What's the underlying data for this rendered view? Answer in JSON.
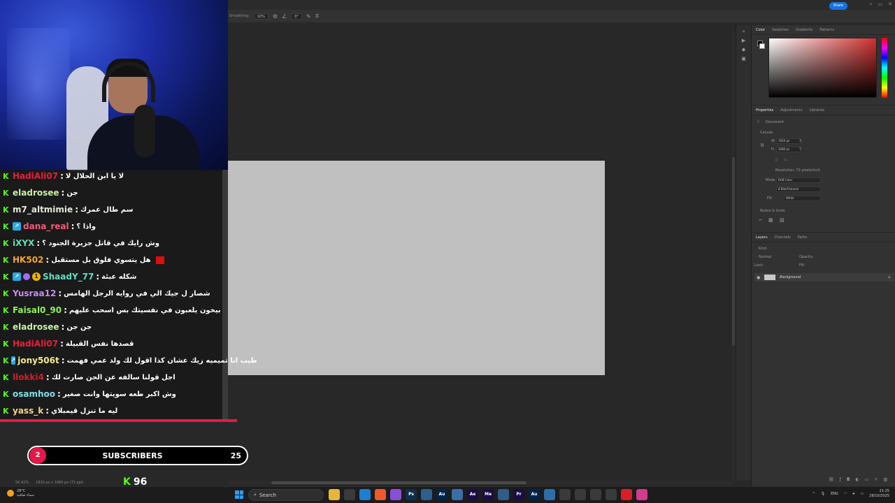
{
  "photoshop": {
    "options_bar": {
      "smoothing_label": "Smoothing:",
      "smoothing_value": "10%",
      "angle_value": "0°"
    },
    "share_label": "Share",
    "status_zoom": "56.92%",
    "status_doc": "1920 px x 1080 px (72 ppi)",
    "color_panel": {
      "tabs": [
        "Color",
        "Swatches",
        "Gradients",
        "Patterns"
      ],
      "fg_color": "#000000",
      "bg_color": "#ffffff",
      "field_hue_color": "#d12f2f"
    },
    "properties_panel": {
      "tabs": [
        "Properties",
        "Adjustments",
        "Libraries"
      ],
      "document_label": "Document",
      "canvas_label": "Canvas",
      "width_label": "W",
      "width_value": "1920 px",
      "height_label": "H",
      "height_value": "1080 px",
      "x_label": "X",
      "y_label": "Y",
      "resolution_text": "Resolution: 72 pixels/inch",
      "mode_label": "Mode",
      "mode_value": "RGB Color",
      "bits_value": "8 Bits/Channel",
      "fill_label": "Fill",
      "fill_value": "White",
      "rulers_label": "Rulers & Grids"
    },
    "layers_panel": {
      "tabs": [
        "Layers",
        "Channels",
        "Paths"
      ],
      "kind_label": "Kind",
      "blend_mode": "Normal",
      "opacity_label": "Opacity:",
      "lock_label": "Lock:",
      "fill_label": "Fill:",
      "layer_name": "Background"
    }
  },
  "chat": {
    "messages": [
      {
        "user": "HadiAli07",
        "user_color": "#e2203f",
        "message": "لا يا ابن الحلال لا",
        "badges": [
          "kick"
        ]
      },
      {
        "user": "eladrosee",
        "user_color": "#c7f0a4",
        "message": "جن",
        "badges": [
          "kick"
        ]
      },
      {
        "user": "m7_altmimie",
        "user_color": "#e4e9d7",
        "message": "سم طال عمرك",
        "badges": [
          "kick"
        ]
      },
      {
        "user": "dana_real",
        "user_color": "#f25b7b",
        "message": "واذا ؟",
        "badges": [
          "kick",
          "blue"
        ]
      },
      {
        "user": "iXYX",
        "user_color": "#62e0b7",
        "message": "وش رايك في قاتل جزيرة الجنود ؟",
        "badges": [
          "kick"
        ]
      },
      {
        "user": "HK502",
        "user_color": "#f5a623",
        "message": "هل يتسوي فلوق بل مستقبل",
        "badges": [
          "kick"
        ],
        "trailing_red": true
      },
      {
        "user": "ShaadY_77",
        "user_color": "#5ce0c3",
        "message": "شكله عبئة",
        "badges": [
          "kick",
          "blue",
          "purple",
          "gold"
        ]
      },
      {
        "user": "Yusraa12",
        "user_color": "#c78df0",
        "message": "شصار ل جيك الي في روايه الرجل الهامس",
        "badges": [
          "kick"
        ]
      },
      {
        "user": "Faisal0_90",
        "user_color": "#8ff25b",
        "message": "بيخون يلعبون في نفسيتك بس اسحب عليهم",
        "badges": [
          "kick"
        ]
      },
      {
        "user": "eladrosee",
        "user_color": "#c7f0a4",
        "message": "جن جن",
        "badges": [
          "kick"
        ]
      },
      {
        "user": "HadiAli07",
        "user_color": "#e2203f",
        "message": "قصدها نفس القبيلة",
        "badges": [
          "kick"
        ]
      },
      {
        "user": "jony506t",
        "user_color": "#f5ec87",
        "message": "طيب انا تميميه زيك عشان كذا اقول لك ولد عمي فهمت",
        "badges": [
          "kick",
          "blue"
        ]
      },
      {
        "user": "llokki4",
        "user_color": "#cf1f2d",
        "message": "اجل قولنا سالفه عن الجن صارت لك",
        "badges": [
          "kick"
        ]
      },
      {
        "user": "osamhoo",
        "user_color": "#7fe0e6",
        "message": "وش اكبر طعه سويتها وانت صغير",
        "badges": [
          "kick"
        ]
      },
      {
        "user": "yass_k",
        "user_color": "#f2d28c",
        "message": "ليه ما تنزل قيمبلاي",
        "badges": [
          "kick"
        ]
      }
    ]
  },
  "subs_goal": {
    "current": "2",
    "label": "SUBSCRIBERS",
    "goal": "25"
  },
  "viewers": {
    "icon": "K",
    "count": "96"
  },
  "taskbar": {
    "weather_temp": "28°C",
    "weather_desc": "سماء صافية",
    "search_placeholder": "Search",
    "lang": "ENG",
    "time": "21:25",
    "date": "28/10/2025",
    "apps": [
      {
        "name": "file-explorer",
        "label": "",
        "color": "#e8b53a"
      },
      {
        "name": "store",
        "label": "",
        "color": "#3a3a3a"
      },
      {
        "name": "vscode",
        "label": "",
        "color": "#1e7fd1"
      },
      {
        "name": "brave",
        "label": "",
        "color": "#f05a28"
      },
      {
        "name": "visual-studio",
        "label": "",
        "color": "#8a4fd8"
      },
      {
        "name": "photoshop",
        "label": "Ps",
        "color": "#0f2e4d"
      },
      {
        "name": "app-star",
        "label": "",
        "color": "#2c5f8e"
      },
      {
        "name": "audition",
        "label": "Au",
        "color": "#00254a"
      },
      {
        "name": "app-window",
        "label": "",
        "color": "#3b6ea8"
      },
      {
        "name": "after-effects",
        "label": "Ae",
        "color": "#1d0b49"
      },
      {
        "name": "media-encoder",
        "label": "Me",
        "color": "#1d0b49"
      },
      {
        "name": "app-box",
        "label": "",
        "color": "#2f5c88"
      },
      {
        "name": "premiere",
        "label": "Pr",
        "color": "#1d0b49"
      },
      {
        "name": "audition-2",
        "label": "Au",
        "color": "#00254a"
      },
      {
        "name": "app-drop",
        "label": "",
        "color": "#2d6ea8"
      },
      {
        "name": "app-code",
        "label": "",
        "color": "#3a3a3a"
      },
      {
        "name": "app-cube",
        "label": "",
        "color": "#3a3a3a"
      },
      {
        "name": "app-mail",
        "label": "",
        "color": "#3a3a3a"
      },
      {
        "name": "app-gear",
        "label": "",
        "color": "#3a3a3a"
      },
      {
        "name": "opera",
        "label": "",
        "color": "#d81f26"
      },
      {
        "name": "app-chat",
        "label": "",
        "color": "#d23a8c"
      }
    ]
  }
}
